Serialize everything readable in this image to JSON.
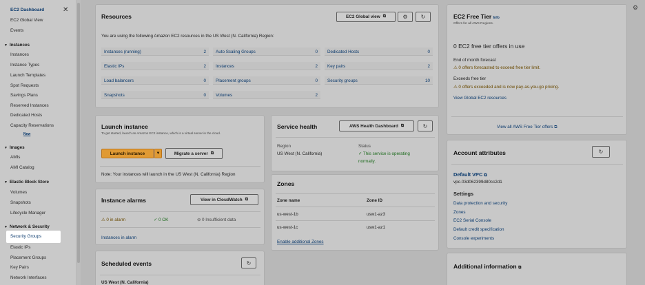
{
  "sidebar": {
    "title": "EC2 Dashboard",
    "top_items": [
      "EC2 Global View",
      "Events"
    ],
    "sections": {
      "instances": "Instances",
      "images": "Images",
      "ebs": "Elastic Block Store",
      "network": "Network & Security"
    },
    "instances_items": [
      "Instances",
      "Instance Types",
      "Launch Templates",
      "Spot Requests",
      "Savings Plans",
      "Reserved Instances",
      "Dedicated Hosts",
      "Capacity Reservations"
    ],
    "new_badge": "New",
    "images_items": [
      "AMIs",
      "AMI Catalog"
    ],
    "ebs_items": [
      "Volumes",
      "Snapshots",
      "Lifecycle Manager"
    ],
    "network_items": [
      "Security Groups",
      "Elastic IPs",
      "Placement Groups",
      "Key Pairs",
      "Network Interfaces"
    ]
  },
  "resources": {
    "title": "Resources",
    "global_view_btn": "EC2 Global view",
    "intro": "You are using the following Amazon EC2 resources in the US West (N. California) Region:",
    "cells": [
      {
        "label": "Instances (running)",
        "value": "2"
      },
      {
        "label": "Auto Scaling Groups",
        "value": "0"
      },
      {
        "label": "Dedicated Hosts",
        "value": "0"
      },
      {
        "label": "Elastic IPs",
        "value": "2"
      },
      {
        "label": "Instances",
        "value": "2"
      },
      {
        "label": "Key pairs",
        "value": "2"
      },
      {
        "label": "Load balancers",
        "value": "0"
      },
      {
        "label": "Placement groups",
        "value": "0"
      },
      {
        "label": "Security groups",
        "value": "10"
      },
      {
        "label": "Snapshots",
        "value": "0"
      },
      {
        "label": "Volumes",
        "value": "2"
      }
    ]
  },
  "launch": {
    "title": "Launch instance",
    "desc": "To get started, launch an Amazon EC2 instance, which is a virtual server in the cloud.",
    "launch_btn": "Launch instance",
    "migrate_btn": "Migrate a server",
    "note": "Note: Your instances will launch in the US West (N. California) Region"
  },
  "service_health": {
    "title": "Service health",
    "dashboard_btn": "AWS Health Dashboard",
    "region_label": "Region",
    "region_value": "US West (N. California)",
    "status_label": "Status",
    "status_value_1": "This service is operating",
    "status_value_2": "normally."
  },
  "alarms": {
    "title": "Instance alarms",
    "cloudwatch_btn": "View in CloudWatch",
    "in_alarm": "0 in alarm",
    "ok": "0 OK",
    "insufficient": "0 Insufficient data",
    "link": "Instances in alarm"
  },
  "zones": {
    "title": "Zones",
    "col_name": "Zone name",
    "col_id": "Zone ID",
    "rows": [
      {
        "name": "us-west-1b",
        "id": "usw1-az3"
      },
      {
        "name": "us-west-1c",
        "id": "usw1-az1"
      }
    ],
    "enable_link": "Enable additional Zones"
  },
  "scheduled": {
    "title": "Scheduled events",
    "sub": "US West (N. California)"
  },
  "free_tier": {
    "title": "EC2 Free Tier",
    "info": "Info",
    "subtitle": "Offers for all AWS Regions.",
    "headline": "0 EC2 free tier offers in use",
    "forecast_label": "End of month forecast",
    "forecast_text": "0 offers forecasted to exceed free tier limit.",
    "exceeds_label": "Exceeds free tier",
    "exceeds_text": "0 offers exceeded and is now pay-as-you-go pricing.",
    "global_link": "View Global EC2 resources",
    "all_offers_link": "View all AWS Free Tier offers"
  },
  "account": {
    "title": "Account attributes",
    "default_vpc": "Default VPC",
    "vpc_id": "vpc-03d062399d80cc2d1",
    "settings": "Settings",
    "links": [
      "Data protection and security",
      "Zones",
      "EC2 Serial Console",
      "Default credit specification",
      "Console experiments"
    ]
  },
  "additional": {
    "title": "Additional information"
  }
}
